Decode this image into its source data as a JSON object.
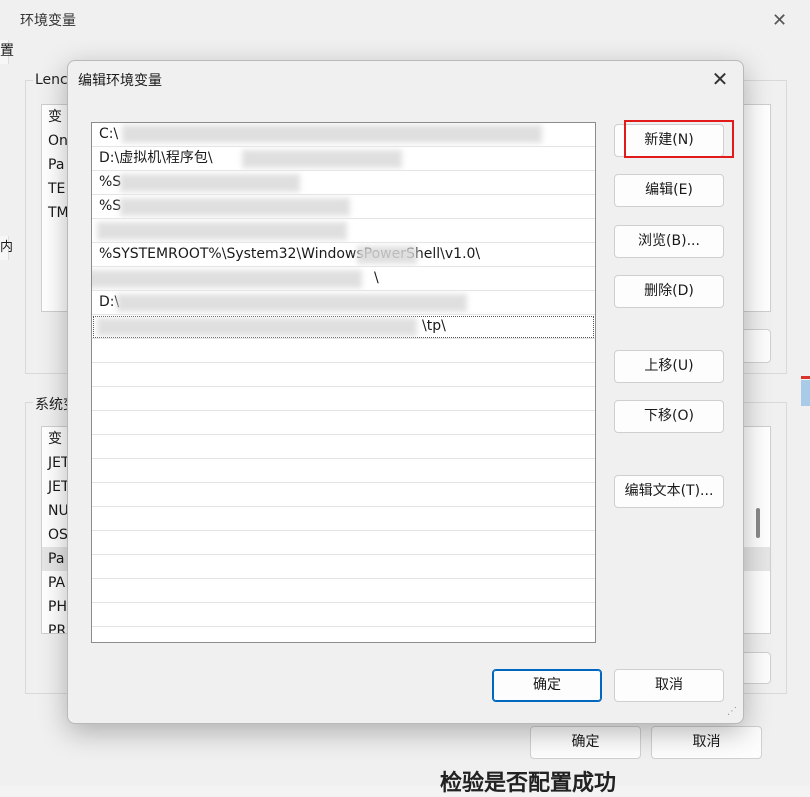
{
  "background_window": {
    "title": "环境变量",
    "close_glyph": "✕",
    "user_group_label": "Lenc",
    "user_vars": [
      "变",
      "On",
      "Pa",
      "TE",
      "TM"
    ],
    "system_group_label": "系统变",
    "system_vars": [
      "变",
      "JET",
      "JET",
      "NU",
      "OS",
      "Pa",
      "PA",
      "PH",
      "PR"
    ],
    "ok_label": "确定",
    "cancel_label": "取消",
    "left_edge_glyphs": [
      "置",
      "内"
    ],
    "bottom_text": "检验是否配置成功"
  },
  "dialog": {
    "title": "编辑环境变量",
    "close_glyph": "✕",
    "paths": [
      "C:\\",
      "D:\\虚拟机\\程序包\\",
      "%S",
      "%S",
      "",
      "%SYSTEMROOT%\\System32\\WindowsPowerShell\\v1.0\\",
      "\\",
      "D:\\",
      "\\tp\\"
    ],
    "empty_rows": 13,
    "buttons": {
      "new": "新建(N)",
      "edit": "编辑(E)",
      "browse": "浏览(B)...",
      "delete": "删除(D)",
      "move_up": "上移(U)",
      "move_down": "下移(O)",
      "edit_text": "编辑文本(T)...",
      "ok": "确定",
      "cancel": "取消"
    },
    "highlight_color": "#e11b1b"
  }
}
